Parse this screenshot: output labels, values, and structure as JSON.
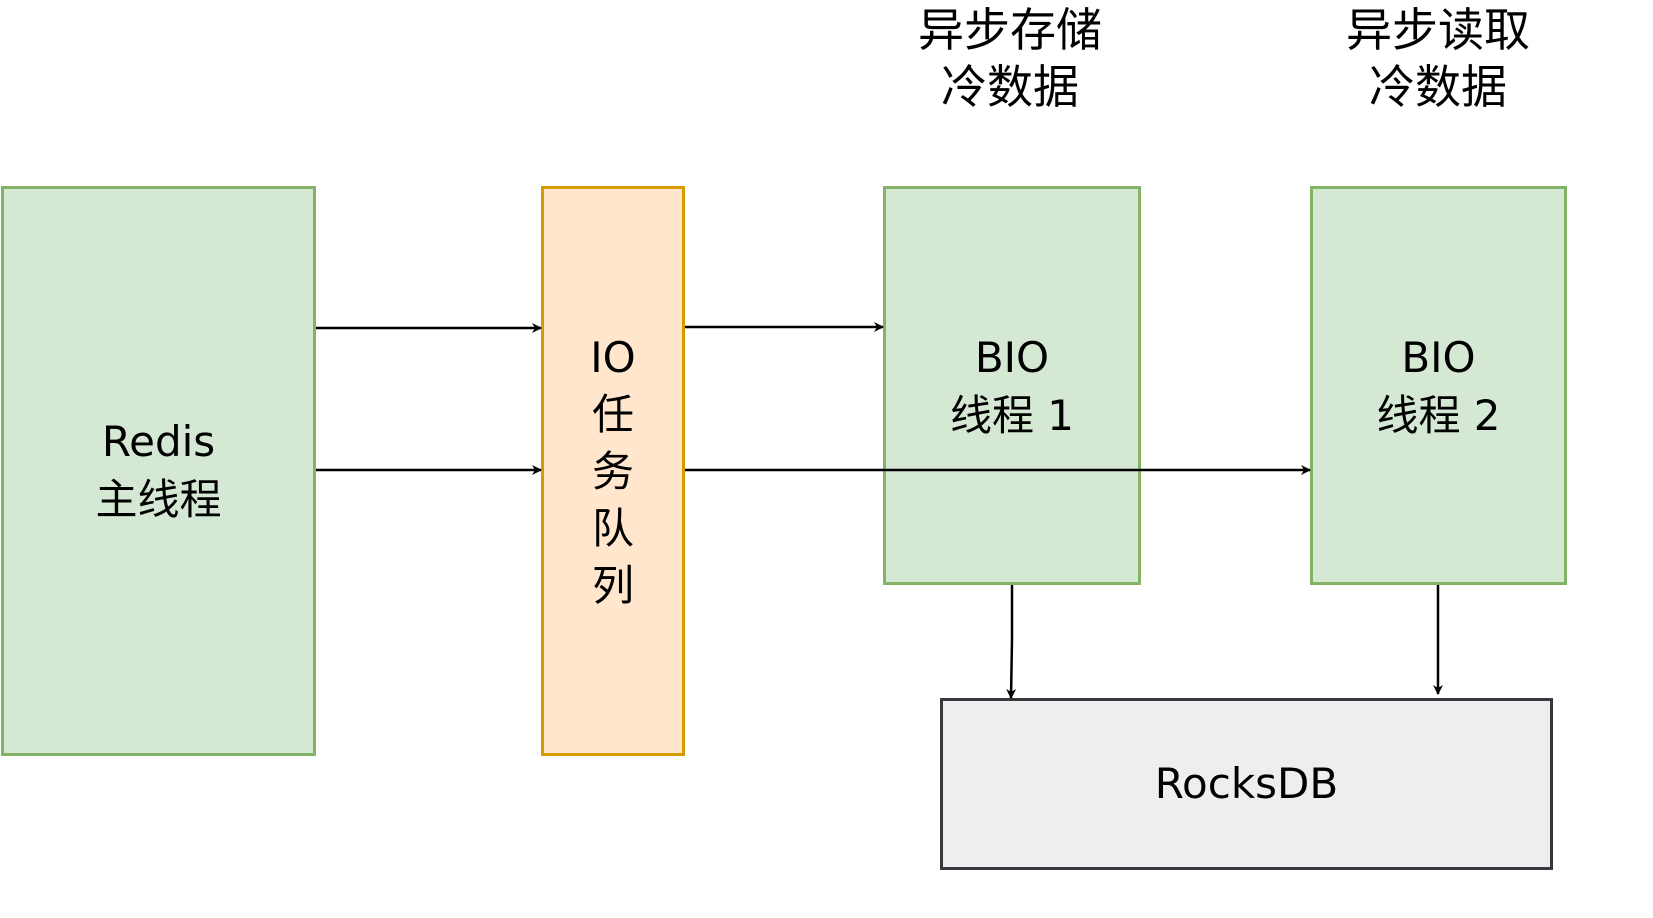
{
  "nodes": {
    "redis_main": {
      "lines": [
        "Redis",
        "主线程"
      ]
    },
    "io_queue": {
      "chars": [
        "IO",
        "任",
        "务",
        "队",
        "列"
      ]
    },
    "bio_thread_1": {
      "lines": [
        "BIO",
        "线程 1"
      ]
    },
    "bio_thread_2": {
      "lines": [
        "BIO",
        "线程 2"
      ]
    },
    "rocksdb": {
      "label": "RocksDB"
    }
  },
  "captions": {
    "store_cold": [
      "异步存储",
      "冷数据"
    ],
    "read_cold": [
      "异步读取",
      "冷数据"
    ]
  },
  "edges": [
    {
      "from": "redis_main",
      "to": "io_queue"
    },
    {
      "from": "redis_main",
      "to": "io_queue"
    },
    {
      "from": "io_queue",
      "to": "bio_thread_1"
    },
    {
      "from": "io_queue",
      "to": "bio_thread_2"
    },
    {
      "from": "bio_thread_1",
      "to": "rocksdb"
    },
    {
      "from": "bio_thread_2",
      "to": "rocksdb"
    }
  ],
  "colors": {
    "thread_fill": "#d5e8d4",
    "thread_border": "#82b366",
    "queue_fill": "#ffe6cc",
    "queue_border": "#d79b00",
    "storage_fill": "#eeeeee",
    "storage_border": "#36393d",
    "arrow": "#000000"
  }
}
